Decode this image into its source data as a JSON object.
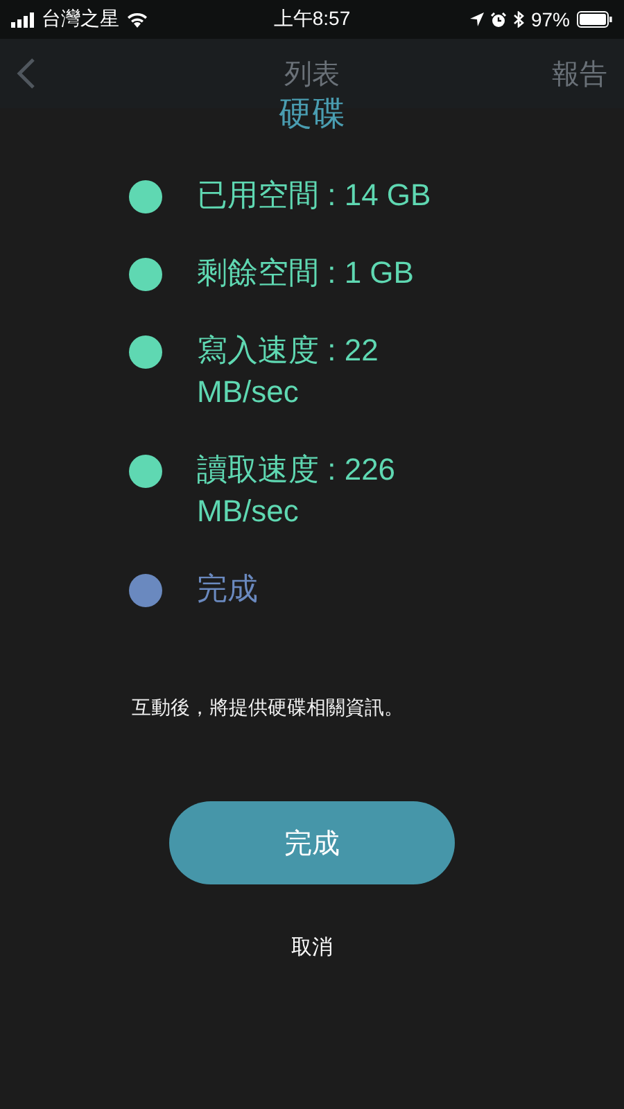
{
  "status_bar": {
    "carrier": "台灣之星",
    "time": "上午8:57",
    "battery": "97%"
  },
  "nav": {
    "title": "列表",
    "action": "報告"
  },
  "dialog": {
    "title": "硬碟",
    "items": [
      {
        "text": "已用空間 : 14 GB",
        "color": "#5fd8b2"
      },
      {
        "text": "剩餘空間 : 1 GB",
        "color": "#5fd8b2"
      },
      {
        "text": "寫入速度 : 22 MB/sec",
        "color": "#5fd8b2"
      },
      {
        "text": "讀取速度 : 226 MB/sec",
        "color": "#5fd8b2"
      },
      {
        "text": "完成",
        "color": "#6a89bf"
      }
    ],
    "message": "互動後，將提供硬碟相關資訊。",
    "primary_button": "完成",
    "cancel": "取消"
  }
}
